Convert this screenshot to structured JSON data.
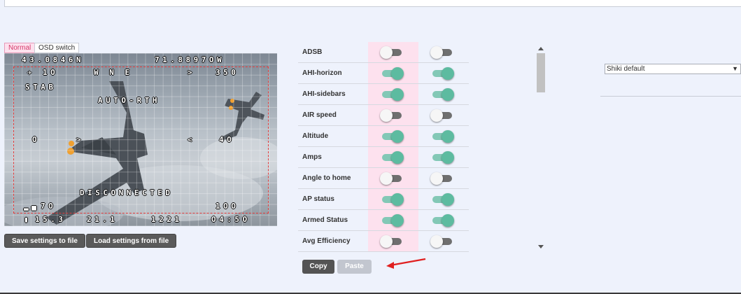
{
  "preview_tabs": [
    "Normal",
    "OSD switch"
  ],
  "osd": {
    "lat": "43.0846N",
    "lon": "71.8897OW",
    "heading_tape": "W    N    E",
    "heading_val": "350",
    "stab": "STAB",
    "auto_rth": "AUTO-RTH",
    "left_val": "O",
    "right_val": "4O",
    "disconnected": "DISCONNECTED",
    "rssi": "7O",
    "alt_right": "1OO",
    "batt_v": "15.3",
    "amps": "21.1",
    "mah": "1221",
    "time": "O4:5O",
    "sat_count": "1O"
  },
  "buttons": {
    "save_settings": "Save settings to file",
    "load_settings": "Load settings from file",
    "copy": "Copy",
    "paste": "Paste"
  },
  "elements": [
    {
      "label": "ADSB",
      "s1": false,
      "s2": false
    },
    {
      "label": "AHI-horizon",
      "s1": true,
      "s2": true
    },
    {
      "label": "AHI-sidebars",
      "s1": true,
      "s2": true
    },
    {
      "label": "AIR speed",
      "s1": false,
      "s2": false
    },
    {
      "label": "Altitude",
      "s1": true,
      "s2": true
    },
    {
      "label": "Amps",
      "s1": true,
      "s2": true
    },
    {
      "label": "Angle to home",
      "s1": false,
      "s2": false
    },
    {
      "label": "AP status",
      "s1": true,
      "s2": true
    },
    {
      "label": "Armed Status",
      "s1": true,
      "s2": true
    },
    {
      "label": "Avg Efficiency",
      "s1": false,
      "s2": false
    }
  ],
  "font_select": {
    "value": "Shiki default"
  },
  "colors": {
    "switch_on": "#5dbba0",
    "active_tab": "#fde1ee",
    "osd_frame": "#e23b3b",
    "arrow": "#e02020"
  },
  "icons": [
    "satellite-icon",
    "battery-icon",
    "signal-icon",
    "red-arrow-icon"
  ]
}
